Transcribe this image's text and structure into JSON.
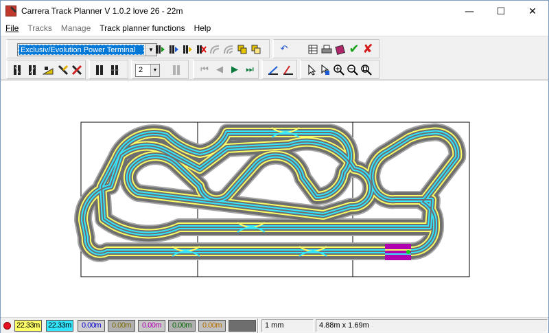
{
  "window": {
    "title": "Carrera Track Planner V 1.0.2 love 26 - 22m"
  },
  "window_controls": {
    "minimize": "—",
    "maximize": "☐",
    "close": "✕"
  },
  "menu": [
    {
      "label": "File",
      "enabled": true
    },
    {
      "label": "Tracks",
      "enabled": false
    },
    {
      "label": "Manage",
      "enabled": false
    },
    {
      "label": "Track planner functions",
      "enabled": true
    },
    {
      "label": "Help",
      "enabled": true
    }
  ],
  "toolbar": {
    "track_system": "Exclusiv/Evolution Power Terminal",
    "lanes_count": "2",
    "row1_icons": [
      "straight-add-icon",
      "straight-add-green-icon",
      "straight-add-blue-icon",
      "straight-add-yellow-icon",
      "straight-delete-icon",
      "curve-icon",
      "curve-double-icon",
      "copy-icon",
      "paste-icon",
      "undo-icon",
      "parts-list-icon",
      "print-icon",
      "book-icon",
      "check-icon",
      "cancel-icon"
    ],
    "row2_icons": [
      "lane-change-icon",
      "lane-change-2-icon",
      "ramp-icon",
      "crossover-icon",
      "crossover-2-icon",
      "straight-short-icon",
      "straight-long-icon",
      "extra-icon",
      "first-icon",
      "prev-icon",
      "next-icon",
      "last-icon",
      "measure-icon",
      "angle-icon",
      "pointer-icon",
      "move-icon",
      "zoom-in-icon",
      "zoom-out-icon",
      "zoom-fit-icon"
    ]
  },
  "colors": {
    "track_surface": "#6e6e6e",
    "lane_a": "#ffff66",
    "lane_b": "#33e5ff",
    "lane_change_marker": "#c0c0c0",
    "power_terminal": "#b000b0",
    "lane_change_shade": "#a6a6a6"
  },
  "status": {
    "lanes": [
      {
        "text": "22.33m",
        "bg": "#ffff66",
        "fg": "#000000"
      },
      {
        "text": "22.33m",
        "bg": "#33e5ff",
        "fg": "#000000"
      },
      {
        "text": "0.00m",
        "bg": "#d0d0d0",
        "fg": "#0000c8"
      },
      {
        "text": "0.00m",
        "bg": "#b0b0b0",
        "fg": "#7a6a00"
      },
      {
        "text": "0.00m",
        "bg": "#c8c8c8",
        "fg": "#b000b0"
      },
      {
        "text": "0.00m",
        "bg": "#b0b0b0",
        "fg": "#006400"
      },
      {
        "text": "0.00m",
        "bg": "#c0c0c0",
        "fg": "#b86d00"
      },
      {
        "text": "",
        "bg": "#6e6e6e",
        "fg": "#000000"
      }
    ],
    "grid": "1 mm",
    "size": "4.88m x 1.69m"
  }
}
